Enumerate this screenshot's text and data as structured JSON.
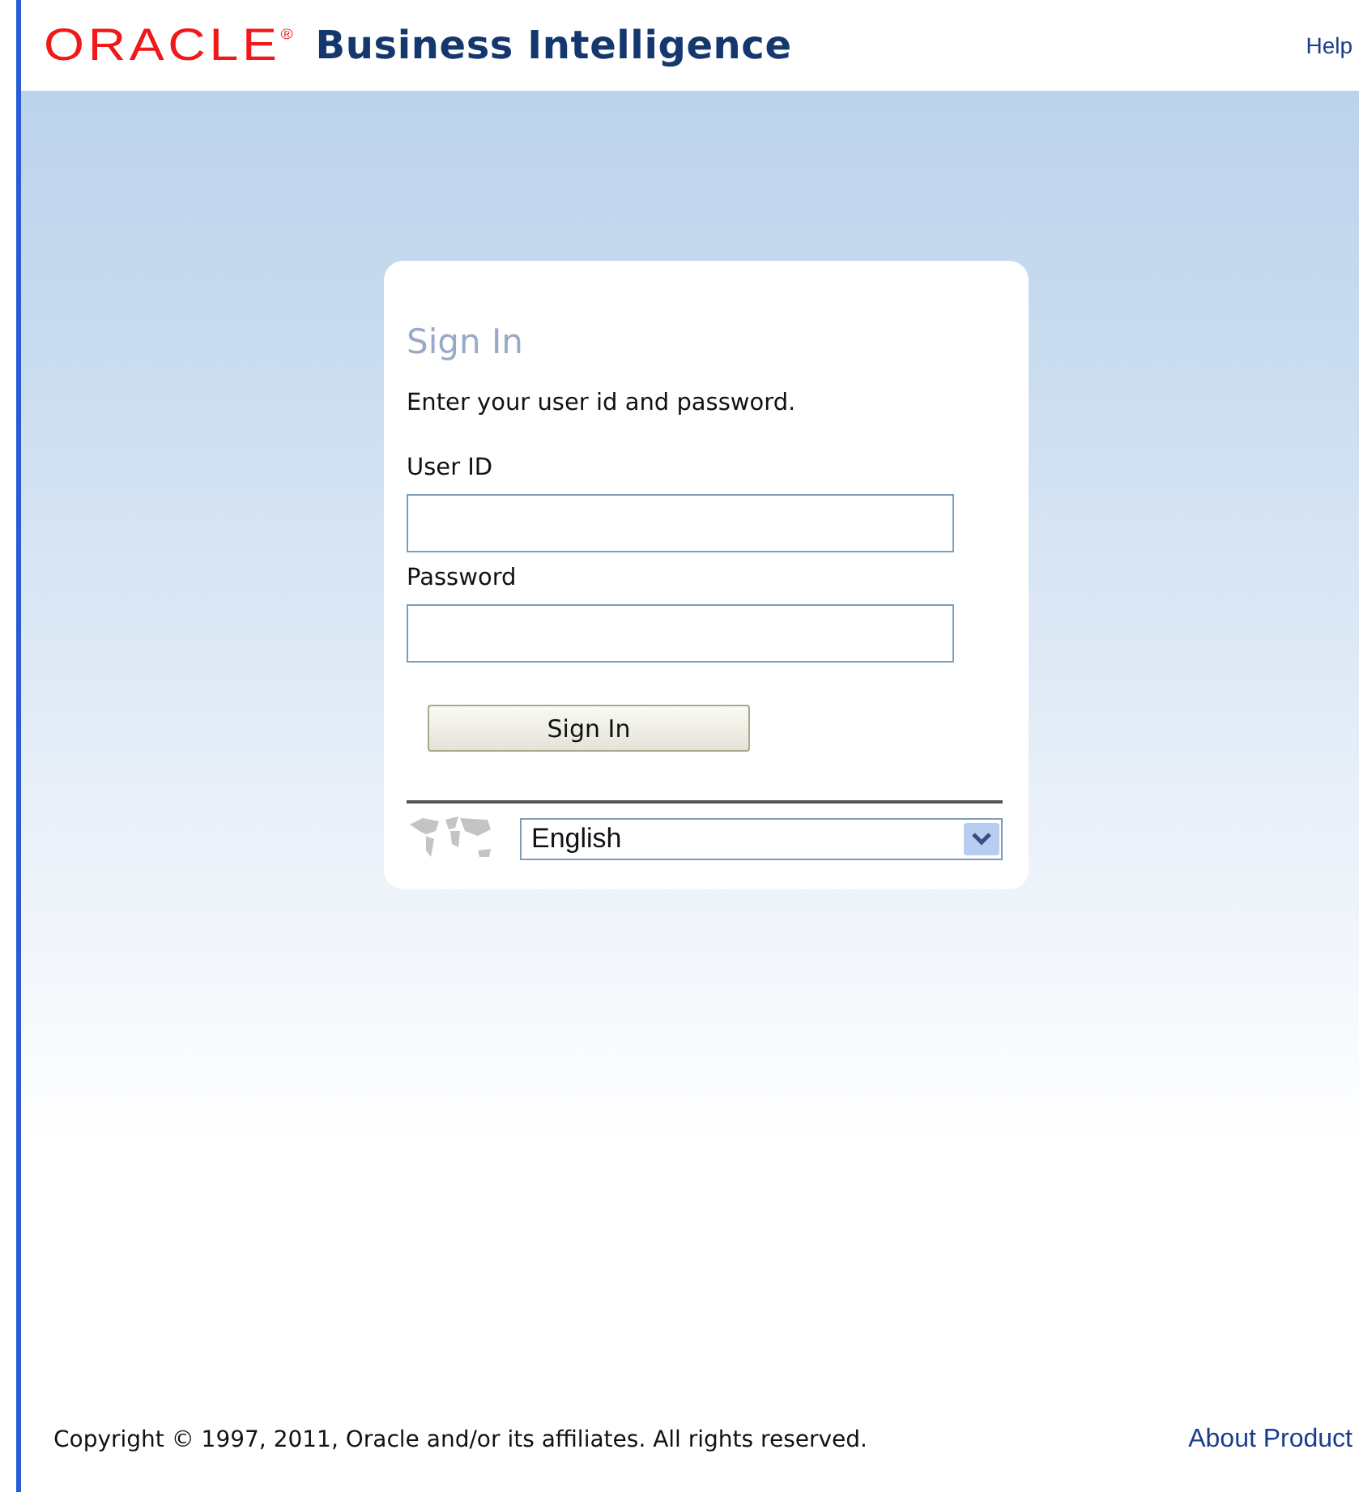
{
  "header": {
    "logo": "ORACLE$^{®}$",
    "product": "Business Intelligence",
    "help_link": "Help"
  },
  "sign_in": {
    "title": "Sign In",
    "instructions": "Enter your user id and password.",
    "fields": [
      {
        "label": "User ID"
      },
      {
        "label": "Password"
      }
    ],
    "button": "Sign In",
    "language": {
      "value": "English"
    }
  },
  "footer": {
    "copyright": "Copyright © 1997, 2011, Oracle and/or its affiliates. All rights reserved.",
    "about_link": "About Product"
  }
}
